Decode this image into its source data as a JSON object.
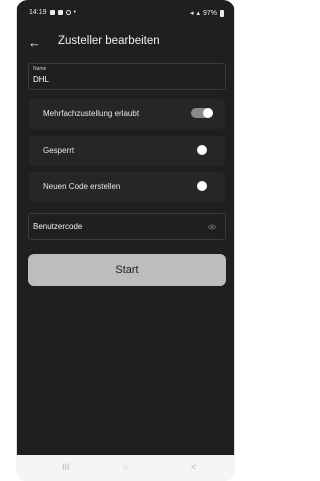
{
  "status_bar": {
    "time": "14:19",
    "battery": "97%"
  },
  "header": {
    "title": "Zusteller bearbeiten"
  },
  "name_field": {
    "label": "Name",
    "value": "DHL"
  },
  "toggles": [
    {
      "label": "Mehrfachzustellung erlaubt",
      "state": "on"
    },
    {
      "label": "Gesperrt",
      "state": "off"
    },
    {
      "label": "Neuen Code erstellen",
      "state": "off"
    }
  ],
  "code_field": {
    "placeholder": "Benutzercode"
  },
  "start_button": {
    "label": "Start"
  },
  "nav": {
    "recents": "III",
    "home": "○",
    "back": "<"
  }
}
